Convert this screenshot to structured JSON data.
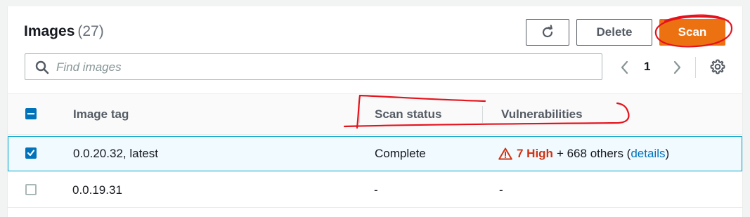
{
  "header": {
    "title": "Images",
    "count": "(27)",
    "delete_label": "Delete",
    "scan_label": "Scan",
    "refresh_icon": "refresh-icon"
  },
  "search": {
    "placeholder": "Find images",
    "value": "",
    "icon": "search-icon"
  },
  "pagination": {
    "current_page": "1",
    "prev_icon": "chevron-left-icon",
    "next_icon": "chevron-right-icon"
  },
  "settings_icon": "gear-icon",
  "table": {
    "columns": [
      "Image tag",
      "Scan status",
      "Vulnerabilities"
    ],
    "rows": [
      {
        "selected": true,
        "tag": "0.0.20.32, latest",
        "scan_status": "Complete",
        "vuln_high": "7 High",
        "vuln_others": "+ 668 others (",
        "vuln_link": "details",
        "vuln_close": ")"
      },
      {
        "selected": false,
        "tag": "0.0.19.31",
        "scan_status": "-",
        "vuln_text": "-"
      }
    ]
  },
  "colors": {
    "accent": "#ec7211",
    "selection": "#0073bb",
    "danger": "#d13212",
    "annotation": "#e5121c"
  }
}
